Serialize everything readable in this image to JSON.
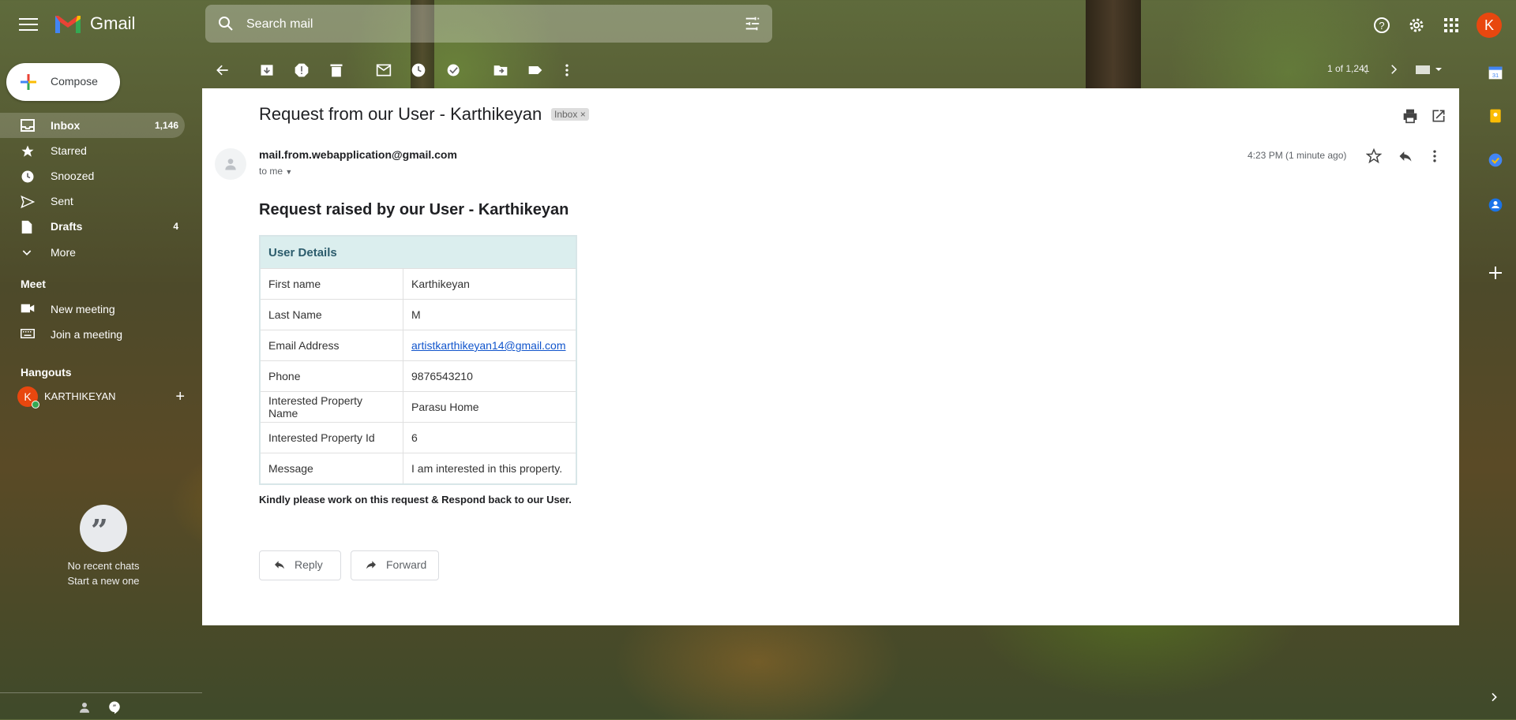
{
  "app": {
    "name": "Gmail"
  },
  "search": {
    "placeholder": "Search mail"
  },
  "account": {
    "initial": "K"
  },
  "compose": {
    "label": "Compose"
  },
  "nav": [
    {
      "label": "Inbox",
      "count": "1,146",
      "icon": "inbox-icon",
      "active": true,
      "bold": true
    },
    {
      "label": "Starred",
      "count": "",
      "icon": "star-icon"
    },
    {
      "label": "Snoozed",
      "count": "",
      "icon": "clock-icon"
    },
    {
      "label": "Sent",
      "count": "",
      "icon": "send-icon"
    },
    {
      "label": "Drafts",
      "count": "4",
      "icon": "draft-icon",
      "bold": true
    },
    {
      "label": "More",
      "count": "",
      "icon": "chevron-down-icon"
    }
  ],
  "meet": {
    "header": "Meet",
    "items": [
      {
        "label": "New meeting",
        "icon": "videocam-icon"
      },
      {
        "label": "Join a meeting",
        "icon": "keyboard-icon"
      }
    ]
  },
  "hangouts": {
    "header": "Hangouts",
    "user_initial": "K",
    "user_name": "KARTHIKEYAN",
    "add": "+",
    "empty_line1": "No recent chats",
    "empty_line2": "Start a new one"
  },
  "toolbar": {
    "pager": "1 of 1,241"
  },
  "email": {
    "subject": "Request from our User - Karthikeyan",
    "label_chip": "Inbox ×",
    "sender": "mail.from.webapplication@gmail.com",
    "to": "to me",
    "time": "4:23 PM (1 minute ago)",
    "body_title": "Request raised by our User - Karthikeyan",
    "table_header": "User Details",
    "rows": [
      {
        "key": "First name",
        "value": "Karthikeyan"
      },
      {
        "key": "Last Name",
        "value": "M"
      },
      {
        "key": "Email Address",
        "value": "artistkarthikeyan14@gmail.com",
        "link": true
      },
      {
        "key": "Phone",
        "value": "9876543210"
      },
      {
        "key": "Interested Property Name",
        "value": "Parasu Home"
      },
      {
        "key": "Interested Property Id",
        "value": "6"
      },
      {
        "key": "Message",
        "value": "I am interested in this property."
      }
    ],
    "closing": "Kindly please work on this request & Respond back to our User.",
    "reply_label": "Reply",
    "forward_label": "Forward"
  },
  "colors": {
    "accent_red": "#e8470f",
    "table_header_bg": "#dbeeee",
    "link": "#1155cc"
  }
}
